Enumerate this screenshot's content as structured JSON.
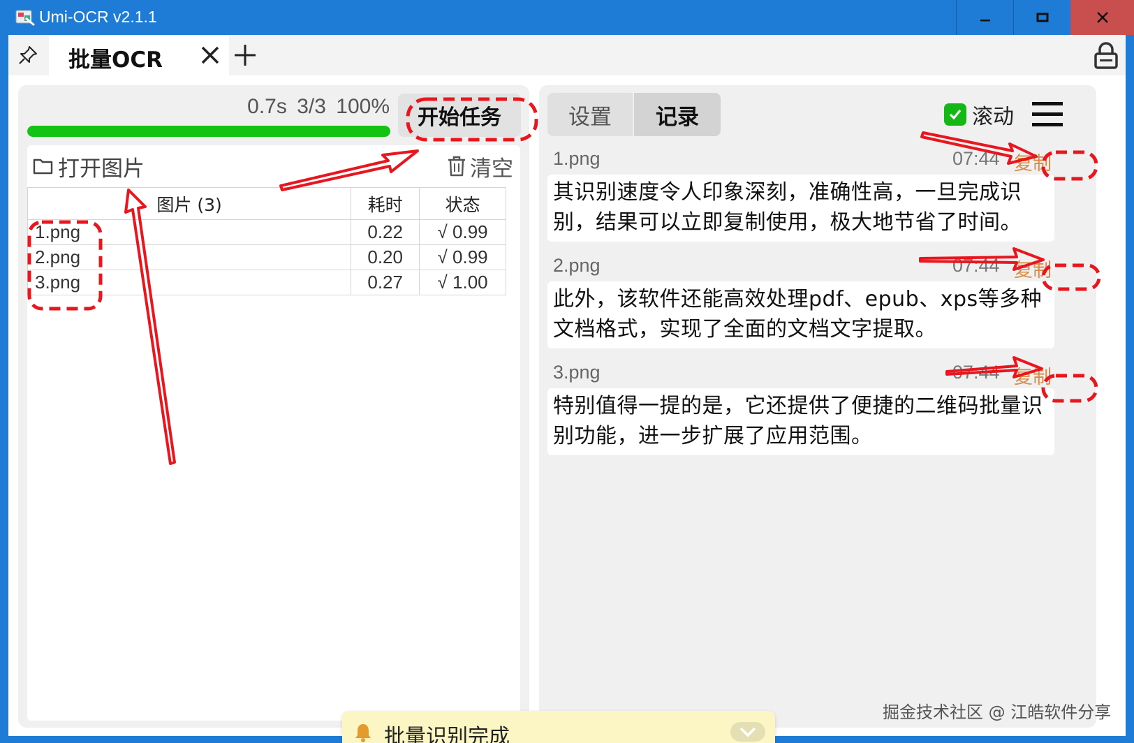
{
  "window": {
    "title": "Umi-OCR v2.1.1",
    "controls": {
      "minimize": "minimize-icon",
      "maximize": "maximize-icon",
      "close": "close-icon"
    }
  },
  "tabbar": {
    "pin_icon": "pin-icon",
    "active_tab_label": "批量OCR",
    "close_icon": "close-icon",
    "add_icon": "plus-icon",
    "lock_icon": "lock-icon"
  },
  "batch": {
    "elapsed": "0.7s",
    "count": "3/3",
    "percent": "100%",
    "progress_fraction": 1.0,
    "start_button": "开始任务",
    "open_images": "打开图片",
    "clear": "清空",
    "table": {
      "headers": [
        "图片 (3)",
        "耗时",
        "状态"
      ],
      "rows": [
        {
          "name": "1.png",
          "time": "0.22",
          "status": "√ 0.99"
        },
        {
          "name": "2.png",
          "time": "0.20",
          "status": "√ 0.99"
        },
        {
          "name": "3.png",
          "time": "0.27",
          "status": "√ 1.00"
        }
      ]
    }
  },
  "right_panel": {
    "tabs": [
      "设置",
      "记录"
    ],
    "active_tab": "记录",
    "scroll_label": "滚动",
    "scroll_checked": true,
    "menu_icon": "menu-icon",
    "records": [
      {
        "file": "1.png",
        "time": "07:44",
        "copy": "复制",
        "text": "其识别速度令人印象深刻，准确性高，一旦完成识别，结果可以立即复制使用，极大地节省了时间。"
      },
      {
        "file": "2.png",
        "time": "07:44",
        "copy": "复制",
        "text": "此外，该软件还能高效处理pdf、epub、xps等多种文档格式，实现了全面的文档文字提取。"
      },
      {
        "file": "3.png",
        "time": "07:44",
        "copy": "复制",
        "text": "特别值得一提的是，它还提供了便捷的二维码批量识别功能，进一步扩展了应用范围。"
      }
    ]
  },
  "toast": {
    "message": "批量识别完成",
    "icon": "bell-icon"
  },
  "watermark": "掘金技术社区 @ 江皓软件分享",
  "colors": {
    "titlebar": "#1e7bd6",
    "progress": "#13c313",
    "copy_link": "#d78b45",
    "annotation": "#e8161e",
    "toast_bg": "#fbf6c4"
  }
}
